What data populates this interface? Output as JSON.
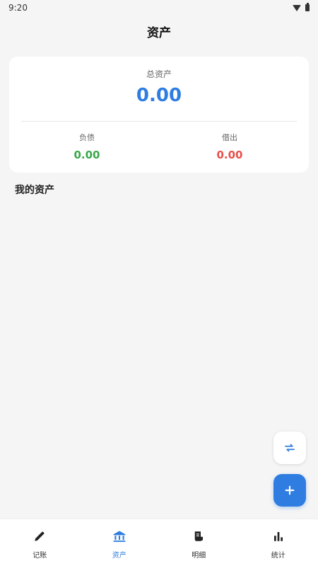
{
  "status_bar": {
    "time": "9:20"
  },
  "header": {
    "title": "资产"
  },
  "summary": {
    "total_label": "总资产",
    "total_value": "0.00",
    "liability_label": "负债",
    "liability_value": "0.00",
    "lent_label": "借出",
    "lent_value": "0.00"
  },
  "section": {
    "title": "我的资产"
  },
  "fab": {
    "transfer_icon": "swap-icon",
    "add_icon": "plus-icon"
  },
  "bottom_nav": {
    "items": [
      {
        "label": "记账",
        "icon": "pencil-icon",
        "active": false
      },
      {
        "label": "资产",
        "icon": "bank-icon",
        "active": true
      },
      {
        "label": "明细",
        "icon": "receipt-icon",
        "active": false
      },
      {
        "label": "统计",
        "icon": "bar-chart-icon",
        "active": false
      }
    ]
  },
  "colors": {
    "accent": "#2f7de1",
    "positive": "#3aa84a",
    "negative": "#e8504a"
  }
}
